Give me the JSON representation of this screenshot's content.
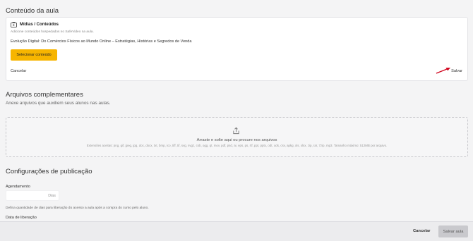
{
  "lesson_content": {
    "title": "Conteúdo da aula",
    "media": {
      "label": "Mídias / Conteúdos",
      "description": "Adicione conteúdos hospedados no SafeVideo na aula.",
      "lesson_title": "Evolução Digital: Do Comércios Físicos ao Mundo Online – Estratégias, Histórias e Segredos de Venda",
      "select_button": "Selecionar conteúdo"
    },
    "cancel_label": "Cancelar",
    "save_label": "Salvar",
    "accent_color": "#f7b500",
    "annotation_arrow_color": "#d0021b"
  },
  "complementary_files": {
    "title": "Arquivos complementares",
    "subtitle": "Anexe arquivos que auxiliem seus alunos nas aulas.",
    "dropzone": {
      "main_text": "Arraste e solte aqui ou procure nos arquivos",
      "extensions_text": "Extensões aceitas: png, gif, jpeg, jpg, doc, docx, txt, bmp, ico, tiff, tif, svg, svgz, csb, ogg, qt, mov, pdf, psd, ai, eps, ps, rtf, ppt, pptx, odt, ods, csv, apkg, xls, xlsx, zip, rar, 7zip, mp3. Tamanho máximo: 512MB por arquivo."
    }
  },
  "publication": {
    "title": "Configurações de publicação",
    "schedule_label": "Agendamento",
    "days_value": "",
    "days_suffix": "Dias",
    "help_text": "Defina quantidade de dias para liberação do acesso a aula após a compra do curso pelo aluno.",
    "release_date_label": "Data de liberação"
  },
  "footer": {
    "cancel_label": "Cancelar",
    "save_label": "Salvar aula"
  }
}
